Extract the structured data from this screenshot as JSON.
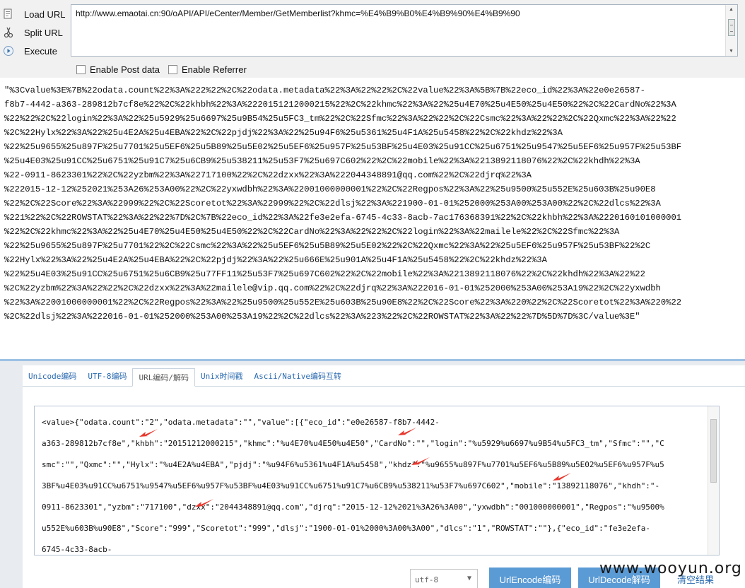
{
  "toolbar": {
    "load_url": "Load URL",
    "split_url": "Split URL",
    "execute": "Execute",
    "url_value": "http://www.emaotai.cn:90/oAPI/API/eCenter/Member/GetMemberlist?khmc=%E4%B9%B0%E4%B9%90%E4%B9%90",
    "enable_post": "Enable Post data",
    "enable_referrer": "Enable Referrer"
  },
  "response": {
    "lines": [
      "\"%3Cvalue%3E%7B%22odata.count%22%3A%222%22%2C%22odata.metadata%22%3A%22%22%2C%22value%22%3A%5B%7B%22eco_id%22%3A%22e0e26587-",
      "f8b7-4442-a363-289812b7cf8e%22%2C%22khbh%22%3A%2220151212000215%22%2C%22khmc%22%3A%22%25u4E70%25u4E50%25u4E50%22%2C%22CardNo%22%3A",
      "%22%22%2C%22login%22%3A%22%25u5929%25u6697%25u9B54%25u5FC3_tm%22%2C%22Sfmc%22%3A%22%22%2C%22Csmc%22%3A%22%22%2C%22Qxmc%22%3A%22%22",
      "%2C%22Hylx%22%3A%22%25u4E2A%25u4EBA%22%2C%22pjdj%22%3A%22%25u94F6%25u5361%25u4F1A%25u5458%22%2C%22khdz%22%3A",
      "%22%25u9655%25u897F%25u7701%25u5EF6%25u5B89%25u5E02%25u5EF6%25u957F%25u53BF%25u4E03%25u91CC%25u6751%25u9547%25u5EF6%25u957F%25u53BF",
      "%25u4E03%25u91CC%25u6751%25u91C7%25u6CB9%25u538211%25u53F7%25u697C602%22%2C%22mobile%22%3A%2213892118076%22%2C%22khdh%22%3A",
      "%22-0911-8623301%22%2C%22yzbm%22%3A%22717100%22%2C%22dzxx%22%3A%222044348891@qq.com%22%2C%22djrq%22%3A",
      "%222015-12-12%252021%253A26%253A00%22%2C%22yxwdbh%22%3A%22001000000001%22%2C%22Regpos%22%3A%22%25u9500%25u552E%25u603B%25u90E8",
      "%22%2C%22Score%22%3A%22999%22%2C%22Scoretot%22%3A%22999%22%2C%22dlsj%22%3A%221900-01-01%252000%253A00%253A00%22%2C%22dlcs%22%3A",
      "%221%22%2C%22ROWSTAT%22%3A%22%22%7D%2C%7B%22eco_id%22%3A%22fe3e2efa-6745-4c33-8acb-7ac176368391%22%2C%22khbh%22%3A%2220160101000001",
      "%22%2C%22khmc%22%3A%22%25u4E70%25u4E50%25u4E50%22%2C%22CardNo%22%3A%22%22%2C%22login%22%3A%22mailele%22%2C%22Sfmc%22%3A",
      "%22%25u9655%25u897F%25u7701%22%2C%22Csmc%22%3A%22%25u5EF6%25u5B89%25u5E02%22%2C%22Qxmc%22%3A%22%25u5EF6%25u957F%25u53BF%22%2C",
      "%22Hylx%22%3A%22%25u4E2A%25u4EBA%22%2C%22pjdj%22%3A%22%25u666E%25u901A%25u4F1A%25u5458%22%2C%22khdz%22%3A",
      "%22%25u4E03%25u91CC%25u6751%25u6CB9%25u77FF11%25u53F7%25u697C602%22%2C%22mobile%22%3A%2213892118076%22%2C%22khdh%22%3A%22%22",
      "%2C%22yzbm%22%3A%22%22%2C%22dzxx%22%3A%22mailele@vip.qq.com%22%2C%22djrq%22%3A%222016-01-01%252000%253A00%253A19%22%2C%22yxwdbh",
      "%22%3A%22001000000001%22%2C%22Regpos%22%3A%22%25u9500%25u552E%25u603B%25u90E8%22%2C%22Score%22%3A%220%22%2C%22Scoretot%22%3A%220%22",
      "%2C%22dlsj%22%3A%222016-01-01%252000%253A00%253A19%22%2C%22dlcs%22%3A%223%22%2C%22ROWSTAT%22%3A%22%22%7D%5D%7D%3C/value%3E\""
    ]
  },
  "tabs": [
    {
      "label": "Unicode编码",
      "active": false
    },
    {
      "label": "UTF-8编码",
      "active": false
    },
    {
      "label": "URL编码/解码",
      "active": true
    },
    {
      "label": "Unix时间戳",
      "active": false
    },
    {
      "label": "Ascii/Native编码互转",
      "active": false
    }
  ],
  "result": {
    "lines": [
      "<value>{\"odata.count\":\"2\",\"odata.metadata\":\"\",\"value\":[{\"eco_id\":\"e0e26587-f8b7-4442-",
      "a363-289812b7cf8e\",\"khbh\":\"20151212000215\",\"khmc\":\"%u4E70%u4E50%u4E50\",\"CardNo\":\"\",\"login\":\"%u5929%u6697%u9B54%u5FC3_tm\",\"Sfmc\":\"\",\"C",
      "smc\":\"\",\"Qxmc\":\"\",\"Hylx\":\"%u4E2A%u4EBA\",\"pjdj\":\"%u94F6%u5361%u4F1A%u5458\",\"khdz\":\"%u9655%u897F%u7701%u5EF6%u5B89%u5E02%u5EF6%u957F%u5",
      "3BF%u4E03%u91CC%u6751%u9547%u5EF6%u957F%u53BF%u4E03%u91CC%u6751%u91C7%u6CB9%u538211%u53F7%u697C602\",\"mobile\":\"13892118076\",\"khdh\":\"-",
      "0911-8623301\",\"yzbm\":\"717100\",\"dzxx\":\"2044348891@qq.com\",\"djrq\":\"2015-12-12%2021%3A26%3A00\",\"yxwdbh\":\"001000000001\",\"Regpos\":\"%u9500%",
      "u552E%u603B%u90E8\",\"Score\":\"999\",\"Scoretot\":\"999\",\"dlsj\":\"1900-01-01%2000%3A00%3A00\",\"dlcs\":\"1\",\"ROWSTAT\":\"\"},{\"eco_id\":\"fe3e2efa-",
      "6745-4c33-8acb-"
    ]
  },
  "encoding": {
    "selected": "utf-8"
  },
  "buttons": {
    "encode": "UrlEncode编码",
    "decode": "UrlDecode解码",
    "clear": "清空结果"
  },
  "watermark": "www.wooyun.org",
  "colors": {
    "accent": "#5b9bd5",
    "annotation_arrow": "#e8382e",
    "tab_link": "#2a6ab0"
  },
  "icons": [
    "load-url-icon",
    "split-url-icon",
    "execute-icon"
  ]
}
